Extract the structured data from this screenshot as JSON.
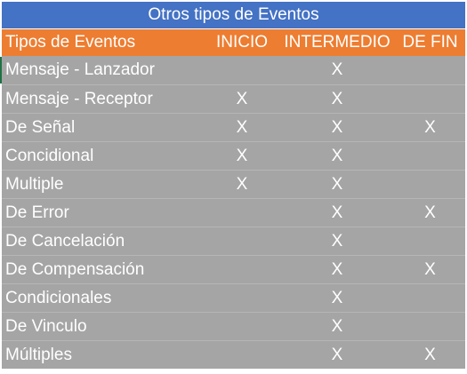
{
  "table": {
    "title": "Otros tipos de Eventos",
    "headers": {
      "name": "Tipos de Eventos",
      "inicio": "INICIO",
      "intermedio": "INTERMEDIO",
      "fin": "DE FIN"
    },
    "rows": [
      {
        "name": "Mensaje - Lanzador",
        "inicio": "",
        "intermedio": "X",
        "fin": ""
      },
      {
        "name": "Mensaje - Receptor",
        "inicio": "X",
        "intermedio": "X",
        "fin": ""
      },
      {
        "name": "De Señal",
        "inicio": "X",
        "intermedio": "X",
        "fin": "X"
      },
      {
        "name": "Concidional",
        "inicio": "X",
        "intermedio": "X",
        "fin": ""
      },
      {
        "name": "Multiple",
        "inicio": "X",
        "intermedio": "X",
        "fin": ""
      },
      {
        "name": "De Error",
        "inicio": "",
        "intermedio": "X",
        "fin": "X"
      },
      {
        "name": "De Cancelación",
        "inicio": "",
        "intermedio": "X",
        "fin": ""
      },
      {
        "name": "De Compensación",
        "inicio": "",
        "intermedio": "X",
        "fin": "X"
      },
      {
        "name": "Condicionales",
        "inicio": "",
        "intermedio": "X",
        "fin": ""
      },
      {
        "name": "De Vinculo",
        "inicio": "",
        "intermedio": "X",
        "fin": ""
      },
      {
        "name": "Múltiples",
        "inicio": "",
        "intermedio": "X",
        "fin": "X"
      }
    ]
  },
  "colors": {
    "title_bg": "#4472c4",
    "header_bg": "#ed7d31",
    "body_bg": "#a5a5a5",
    "text": "#ffffff"
  }
}
